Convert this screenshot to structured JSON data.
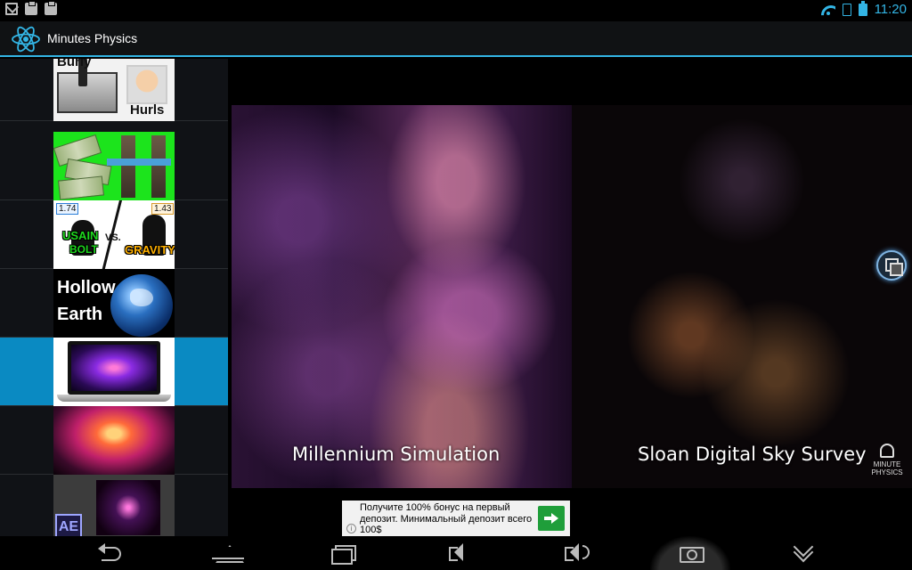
{
  "status_bar": {
    "time": "11:20",
    "notification_icons": [
      "mail-icon",
      "clipboard-check-icon",
      "clipboard-check-icon"
    ],
    "system_icons": [
      "wifi-icon",
      "cell-signal-icon",
      "battery-icon"
    ]
  },
  "action_bar": {
    "title": "Minutes Physics",
    "icon": "atom-icon",
    "accent_color": "#33b5e5"
  },
  "video_list": {
    "selected_index": 4,
    "selected_color": "#0a8ac2",
    "items": [
      {
        "thumbnail": "burly-hurls",
        "texts": [
          "Burly",
          "Hurls"
        ]
      },
      {
        "thumbnail": "money-bridge",
        "texts": []
      },
      {
        "thumbnail": "usain-bolt-vs-gravity",
        "texts": [
          "1.74",
          "1.43",
          "USAIN",
          "BOLT",
          "VS.",
          "GRAVITY"
        ]
      },
      {
        "thumbnail": "hollow-earth",
        "texts": [
          "Hollow",
          "Earth"
        ]
      },
      {
        "thumbnail": "laptop-simulation",
        "texts": []
      },
      {
        "thumbnail": "nebula",
        "texts": []
      },
      {
        "thumbnail": "after-effects",
        "texts": [
          "AE"
        ]
      }
    ]
  },
  "video": {
    "left_caption": "Millennium Simulation",
    "right_caption": "Sloan Digital Sky Survey",
    "watermark": [
      "MINUTE",
      "PHYSICS"
    ]
  },
  "ad": {
    "text": "Получите 100% бонус на первый депозит. Минимальный депозит всего 100$",
    "info_label": "i",
    "button_color": "#1f9e3a"
  },
  "nav_bar": {
    "buttons": [
      "back-icon",
      "home-icon",
      "recent-apps-icon",
      "volume-down-icon",
      "volume-up-icon",
      "screenshot-icon",
      "chevron-down-icon"
    ]
  }
}
